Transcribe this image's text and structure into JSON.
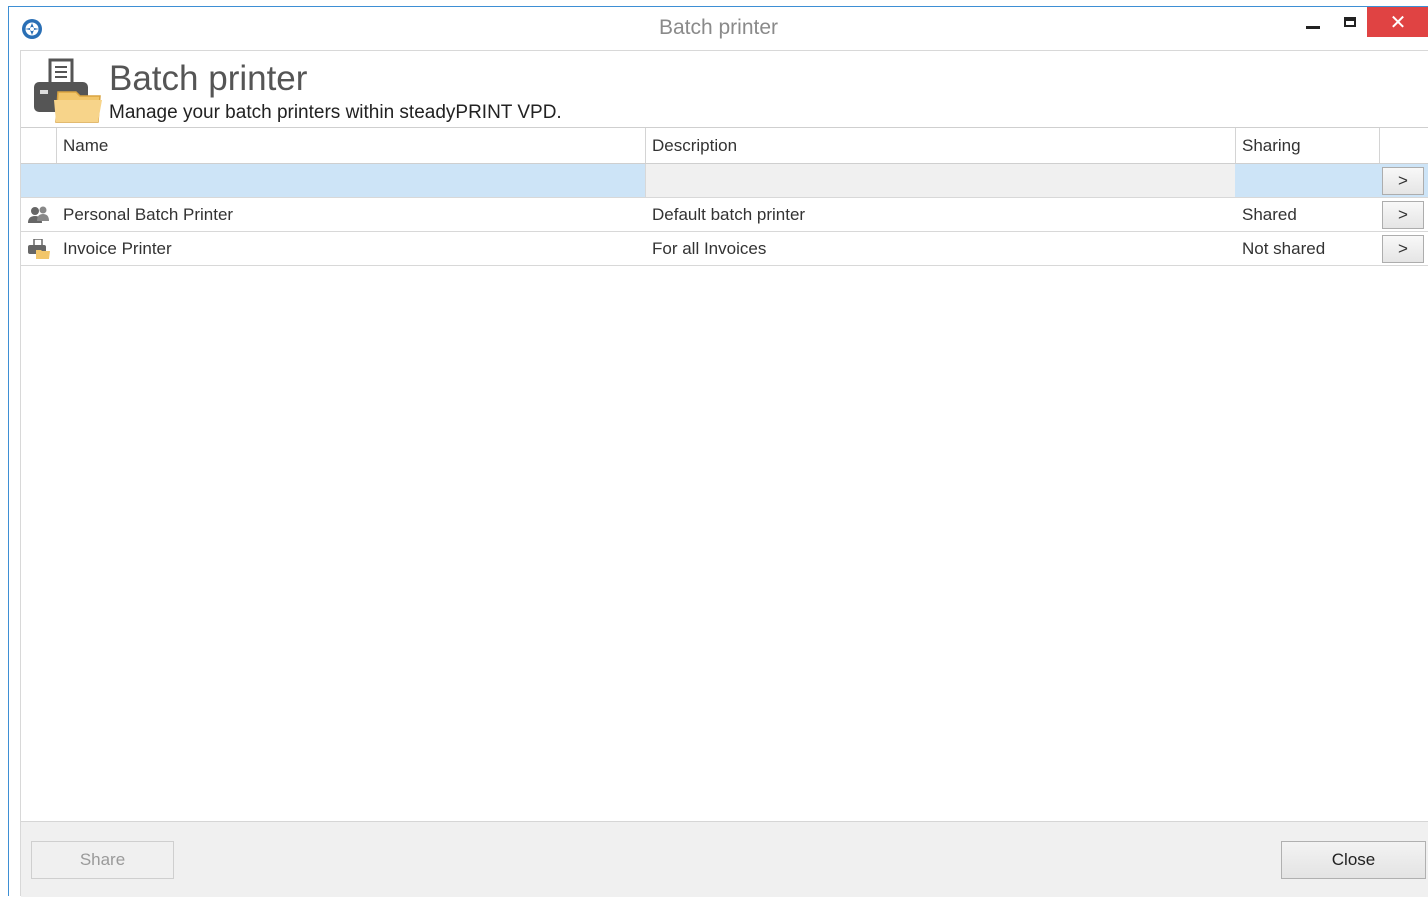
{
  "window": {
    "title": "Batch printer"
  },
  "header": {
    "title": "Batch printer",
    "subtitle": "Manage your batch printers within steadyPRINT VPD."
  },
  "table": {
    "columns": [
      "Name",
      "Description",
      "Sharing"
    ],
    "new_row": {
      "name": "",
      "description": "",
      "sharing": "",
      "arrow": ">"
    },
    "rows": [
      {
        "icon": "shared-users-icon",
        "name": "Personal Batch Printer",
        "description": "Default batch printer",
        "sharing": "Shared",
        "arrow": ">"
      },
      {
        "icon": "printer-icon",
        "name": "Invoice Printer",
        "description": "For all Invoices",
        "sharing": "Not shared",
        "arrow": ">"
      }
    ]
  },
  "footer": {
    "share_label": "Share",
    "close_label": "Close"
  },
  "colors": {
    "accent_border": "#3e8fd4",
    "close_button": "#e04343",
    "selected_row": "#cde4f7"
  }
}
